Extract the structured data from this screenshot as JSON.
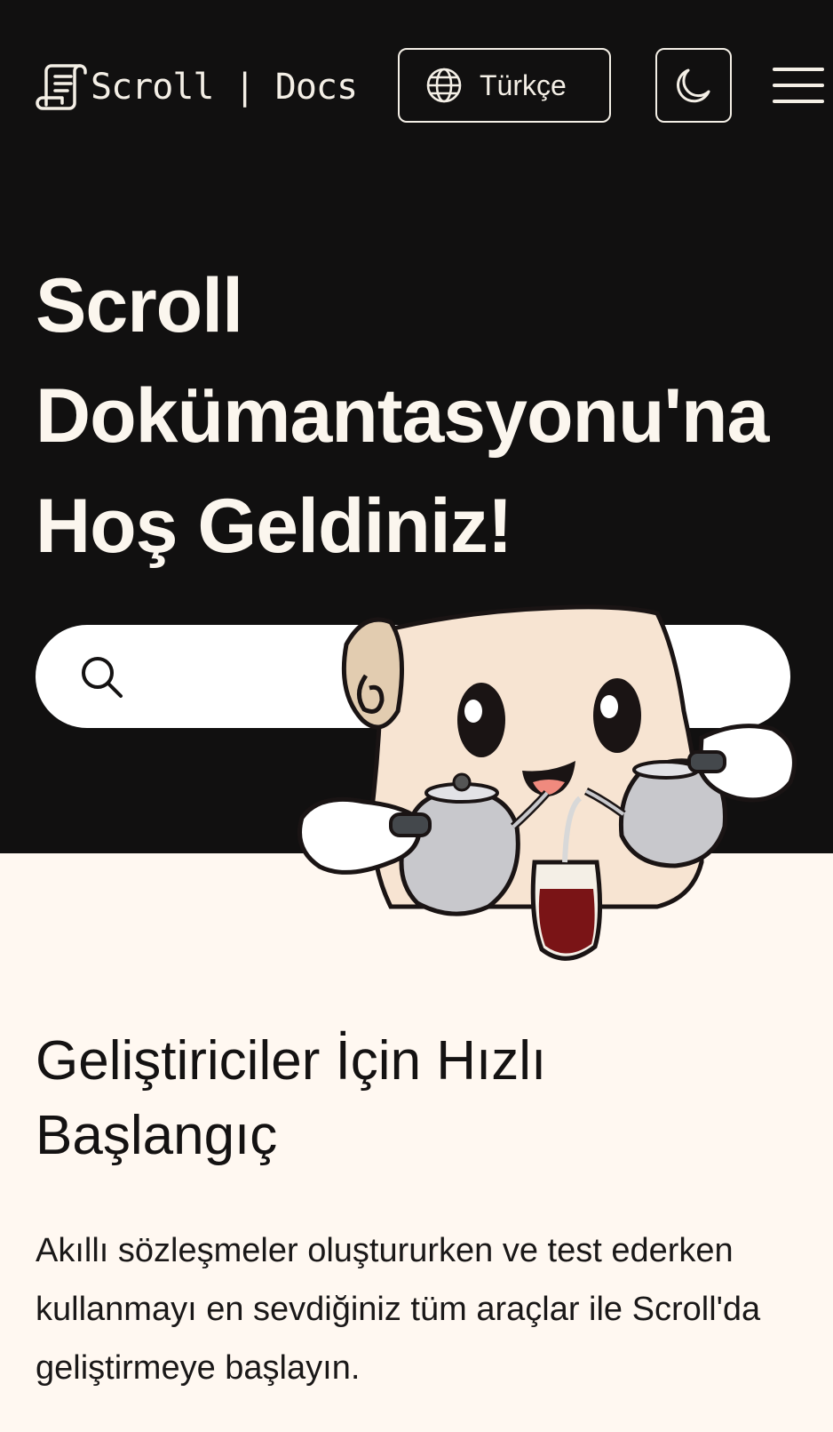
{
  "header": {
    "logo_text": "Scroll | Docs",
    "language_label": "Türkçe"
  },
  "hero": {
    "title_line1": "Scroll",
    "title_line2": "Dokümantasyonu'na",
    "title_line3": "Hoş Geldiniz!"
  },
  "search": {
    "placeholder": ""
  },
  "quickstart": {
    "title_line1": "Geliştiriciler İçin Hızlı",
    "title_line2": "Başlangıç",
    "description": "Akıllı sözleşmeler oluştururken ve test ederken kullanmayı en sevdiğiniz tüm araçlar ile Scroll'da geliştirmeye başlayın."
  },
  "colors": {
    "header_bg": "#111010",
    "page_bg": "#fff8f1",
    "text_light": "#f4efe6",
    "text_dark": "#141212"
  },
  "icons": [
    "scroll-logo-icon",
    "globe-icon",
    "moon-icon",
    "hamburger-menu-icon",
    "search-icon",
    "scroll-mascot-illustration"
  ]
}
